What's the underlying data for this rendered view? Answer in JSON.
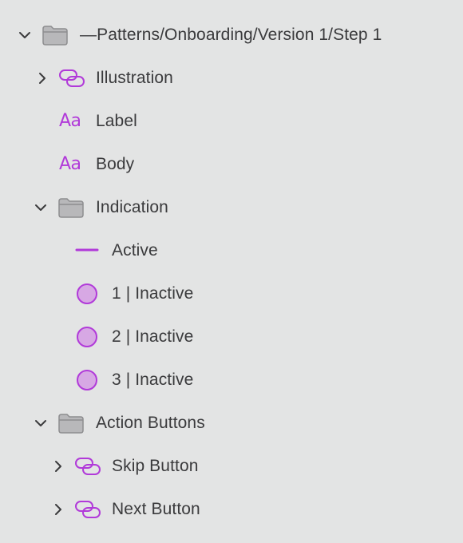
{
  "colors": {
    "background": "#e3e4e4",
    "text": "#3a3a3c",
    "accent": "#b13ad9",
    "circle_fill": "#d7a8e4",
    "folder": "#8d8d8f"
  },
  "layers": [
    {
      "label": "—Patterns/Onboarding/Version 1/Step 1",
      "icon": "folder-icon",
      "chevron": "expanded"
    },
    {
      "label": "Illustration",
      "icon": "component-link-icon",
      "chevron": "collapsed"
    },
    {
      "label": "Label",
      "icon": "text-layer-icon",
      "icon_text": "Aa",
      "chevron": "none"
    },
    {
      "label": "Body",
      "icon": "text-layer-icon",
      "icon_text": "Aa",
      "chevron": "none"
    },
    {
      "label": "Indication",
      "icon": "folder-icon",
      "chevron": "expanded"
    },
    {
      "label": "Active",
      "icon": "line-icon",
      "chevron": "none"
    },
    {
      "label": "1 | Inactive",
      "icon": "circle-icon",
      "chevron": "none"
    },
    {
      "label": "2 | Inactive",
      "icon": "circle-icon",
      "chevron": "none"
    },
    {
      "label": "3 | Inactive",
      "icon": "circle-icon",
      "chevron": "none"
    },
    {
      "label": "Action Buttons",
      "icon": "folder-icon",
      "chevron": "expanded"
    },
    {
      "label": "Skip Button",
      "icon": "component-link-icon",
      "chevron": "collapsed"
    },
    {
      "label": "Next Button",
      "icon": "component-link-icon",
      "chevron": "collapsed"
    }
  ]
}
